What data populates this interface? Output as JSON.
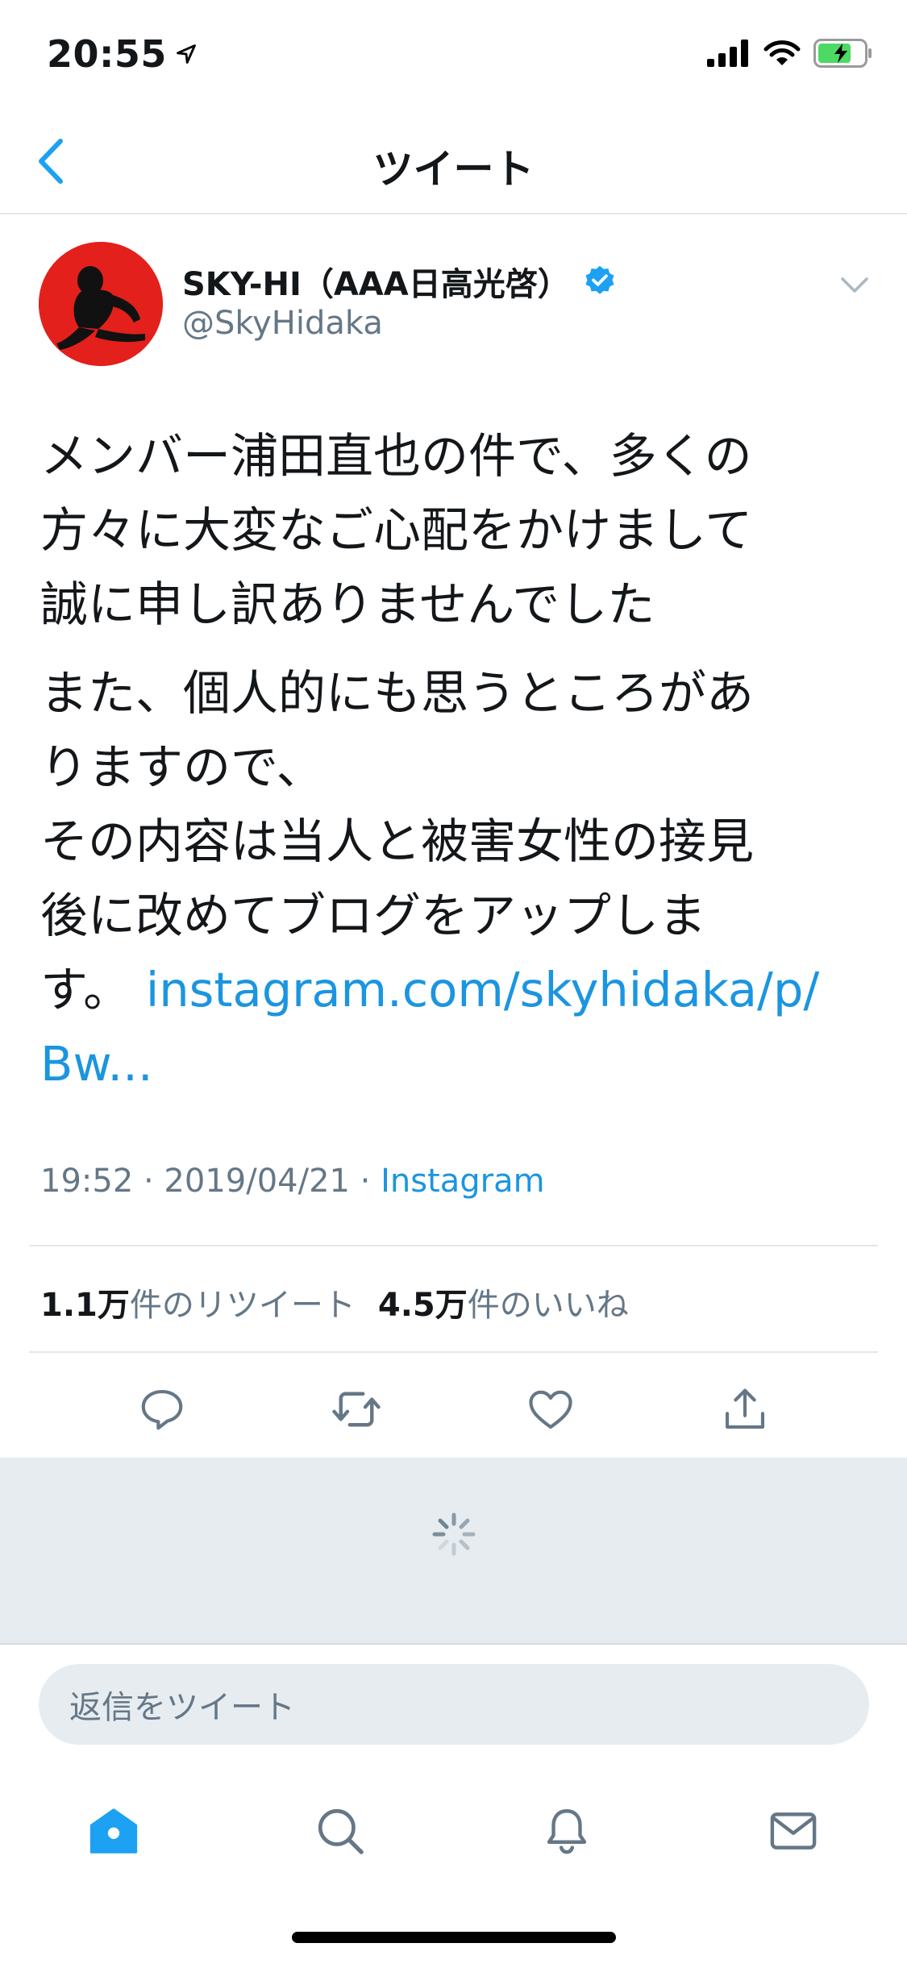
{
  "status_bar": {
    "time": "20:55"
  },
  "nav": {
    "title": "ツイート"
  },
  "tweet": {
    "user_name": "SKY-HI（AAA日高光啓）",
    "handle": "@SkyHidaka",
    "paragraph1": "メンバー浦田直也の件で、多くの\n方々に大変なご心配をかけまして\n誠に申し訳ありませんでした",
    "paragraph2": "また、個人的にも思うところがあ\nりますので、\nその内容は当人と被害女性の接見\n後に改めてブログをアップしま\nす。",
    "link": "instagram.com/skyhidaka/p/\nBw...",
    "time": "19:52 · 2019/04/21 · ",
    "source": "Instagram"
  },
  "stats": {
    "retweet_count": "1.1万",
    "retweet_label": "件のリツイート",
    "like_count": "4.5万",
    "like_label": "件のいいね"
  },
  "reply": {
    "placeholder": "返信をツイート"
  },
  "colors": {
    "accent": "#1da1f2",
    "link": "#1b95e0",
    "muted": "#657786",
    "divider": "#e1e8ed"
  },
  "icons": {
    "back": "chevron-left-icon",
    "verified": "verified-badge-icon",
    "caret": "chevron-down-icon",
    "reply": "reply-icon",
    "retweet": "retweet-icon",
    "like": "heart-icon",
    "share": "share-icon",
    "home": "home-icon",
    "search": "search-icon",
    "notifications": "bell-icon",
    "messages": "mail-icon"
  }
}
